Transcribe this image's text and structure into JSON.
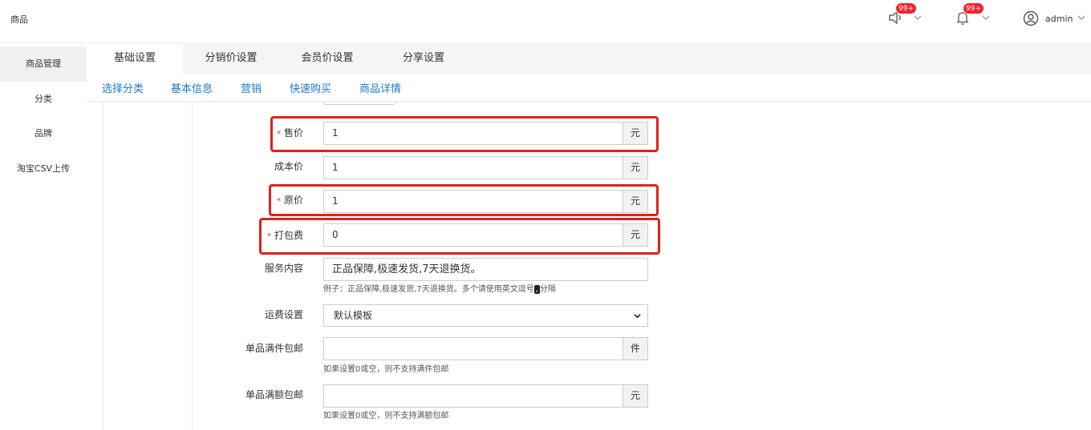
{
  "app": {
    "title": "商品"
  },
  "header": {
    "speaker_badge": "99+",
    "bell_badge": "99+",
    "user_name": "admin"
  },
  "sidebar": {
    "items": [
      {
        "label": "商品管理",
        "active": true
      },
      {
        "label": "分类"
      },
      {
        "label": "品牌"
      },
      {
        "label": "淘宝CSV上传"
      }
    ]
  },
  "tabs": [
    {
      "label": "基础设置",
      "active": true
    },
    {
      "label": "分销价设置"
    },
    {
      "label": "会员价设置"
    },
    {
      "label": "分享设置"
    }
  ],
  "subnav": [
    {
      "label": "选择分类"
    },
    {
      "label": "基本信息"
    },
    {
      "label": "营销"
    },
    {
      "label": "快速购买"
    },
    {
      "label": "商品详情"
    }
  ],
  "form": {
    "sale_price": {
      "label": "售价",
      "value": "1",
      "unit": "元",
      "required": true
    },
    "cost_price": {
      "label": "成本价",
      "value": "1",
      "unit": "元"
    },
    "original_price": {
      "label": "原价",
      "value": "1",
      "unit": "元",
      "required": true
    },
    "packing_fee": {
      "label": "打包费",
      "value": "0",
      "unit": "元",
      "required": true
    },
    "service": {
      "label": "服务内容",
      "value": "正品保障,极速发货,7天退换货。",
      "hint_before": "例子：正品保障,极速发货,7天退换货。多个请使用英文逗号",
      "hint_mark": ",",
      "hint_after": "分隔"
    },
    "shipping": {
      "label": "运费设置",
      "selected": "默认模板"
    },
    "free_ship_count": {
      "label": "单品满件包邮",
      "value": "",
      "unit": "件",
      "hint": "如果设置0或空，则不支持满件包邮"
    },
    "free_ship_amount": {
      "label": "单品满额包邮",
      "value": "",
      "unit": "元",
      "hint": "如果设置0或空，则不支持满额包邮"
    }
  },
  "colors": {
    "accent_link": "#1e78c8",
    "highlight_red": "#e02020",
    "badge_red": "#f5222d"
  },
  "icons": [
    "speaker-icon",
    "bell-icon",
    "user-circle-icon",
    "chevron-down-icon"
  ]
}
